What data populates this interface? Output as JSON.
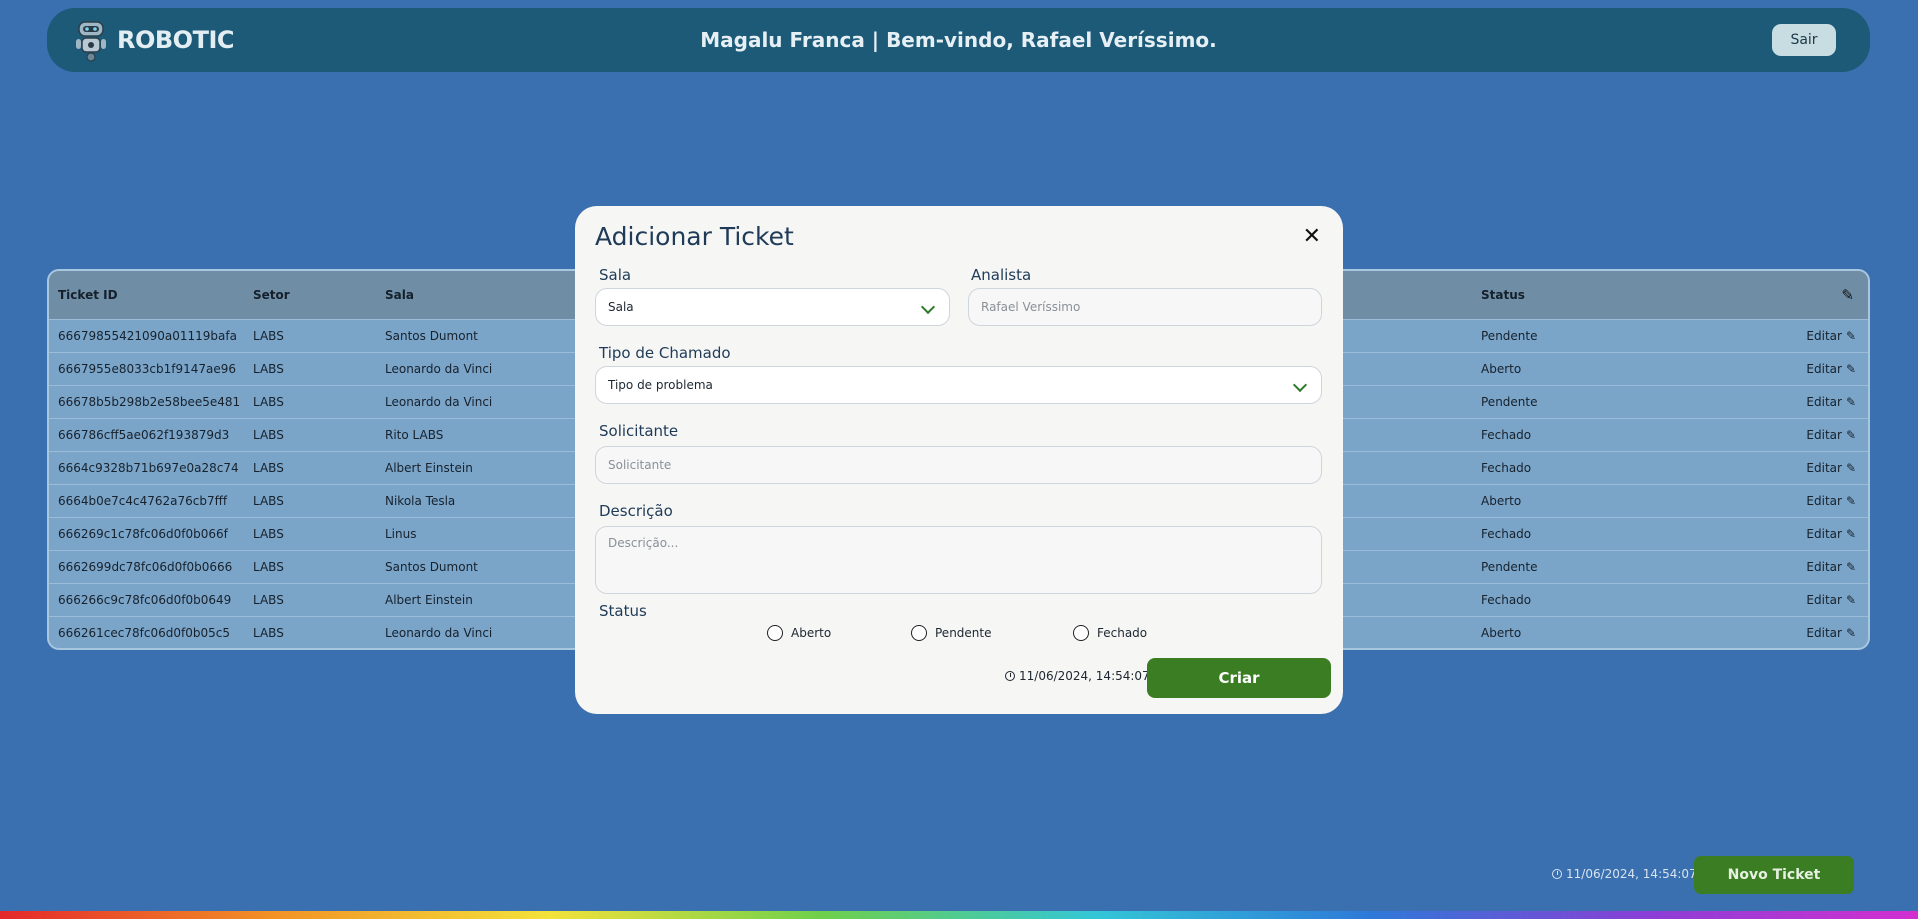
{
  "header": {
    "logo_text": "ROBOTIC",
    "title": "Magalu Franca | Bem-vindo, Rafael Veríssimo.",
    "logout_label": "Sair"
  },
  "table": {
    "columns": [
      "Ticket ID",
      "Setor",
      "Sala",
      "Status"
    ],
    "edit_label": "Editar",
    "rows": [
      {
        "id": "66679855421090a01119bafa",
        "setor": "LABS",
        "sala": "Santos Dumont",
        "status": "Pendente"
      },
      {
        "id": "6667955e8033cb1f9147ae96",
        "setor": "LABS",
        "sala": "Leonardo da Vinci",
        "status": "Aberto"
      },
      {
        "id": "66678b5b298b2e58bee5e481",
        "setor": "LABS",
        "sala": "Leonardo da Vinci",
        "status": "Pendente"
      },
      {
        "id": "666786cff5ae062f193879d3",
        "setor": "LABS",
        "sala": "Rito LABS",
        "status": "Fechado"
      },
      {
        "id": "6664c9328b71b697e0a28c74",
        "setor": "LABS",
        "sala": "Albert Einstein",
        "status": "Fechado"
      },
      {
        "id": "6664b0e7c4c4762a76cb7fff",
        "setor": "LABS",
        "sala": "Nikola Tesla",
        "status": "Aberto"
      },
      {
        "id": "666269c1c78fc06d0f0b066f",
        "setor": "LABS",
        "sala": "Linus",
        "status": "Fechado"
      },
      {
        "id": "6662699dc78fc06d0f0b0666",
        "setor": "LABS",
        "sala": "Santos Dumont",
        "status": "Pendente"
      },
      {
        "id": "666266c9c78fc06d0f0b0649",
        "setor": "LABS",
        "sala": "Albert Einstein",
        "status": "Fechado"
      },
      {
        "id": "666261cec78fc06d0f0b05c5",
        "setor": "LABS",
        "sala": "Leonardo da Vinci",
        "status": "Aberto"
      }
    ]
  },
  "modal": {
    "title": "Adicionar Ticket",
    "sala_label": "Sala",
    "sala_value": "Sala",
    "analista_label": "Analista",
    "analista_placeholder": "Rafael Veríssimo",
    "tipo_label": "Tipo de Chamado",
    "tipo_value": "Tipo de problema",
    "solicitante_label": "Solicitante",
    "solicitante_placeholder": "Solicitante",
    "descricao_label": "Descrição",
    "descricao_placeholder": "Descrição...",
    "status_label": "Status",
    "status_options": [
      "Aberto",
      "Pendente",
      "Fechado"
    ],
    "timestamp": "11/06/2024, 14:54:07",
    "create_label": "Criar"
  },
  "footer": {
    "timestamp": "11/06/2024, 14:54:07",
    "new_ticket_label": "Novo Ticket"
  },
  "colors": {
    "background": "#3a6fb0",
    "header": "#1c5a78",
    "primary_button": "#3b7d22"
  }
}
